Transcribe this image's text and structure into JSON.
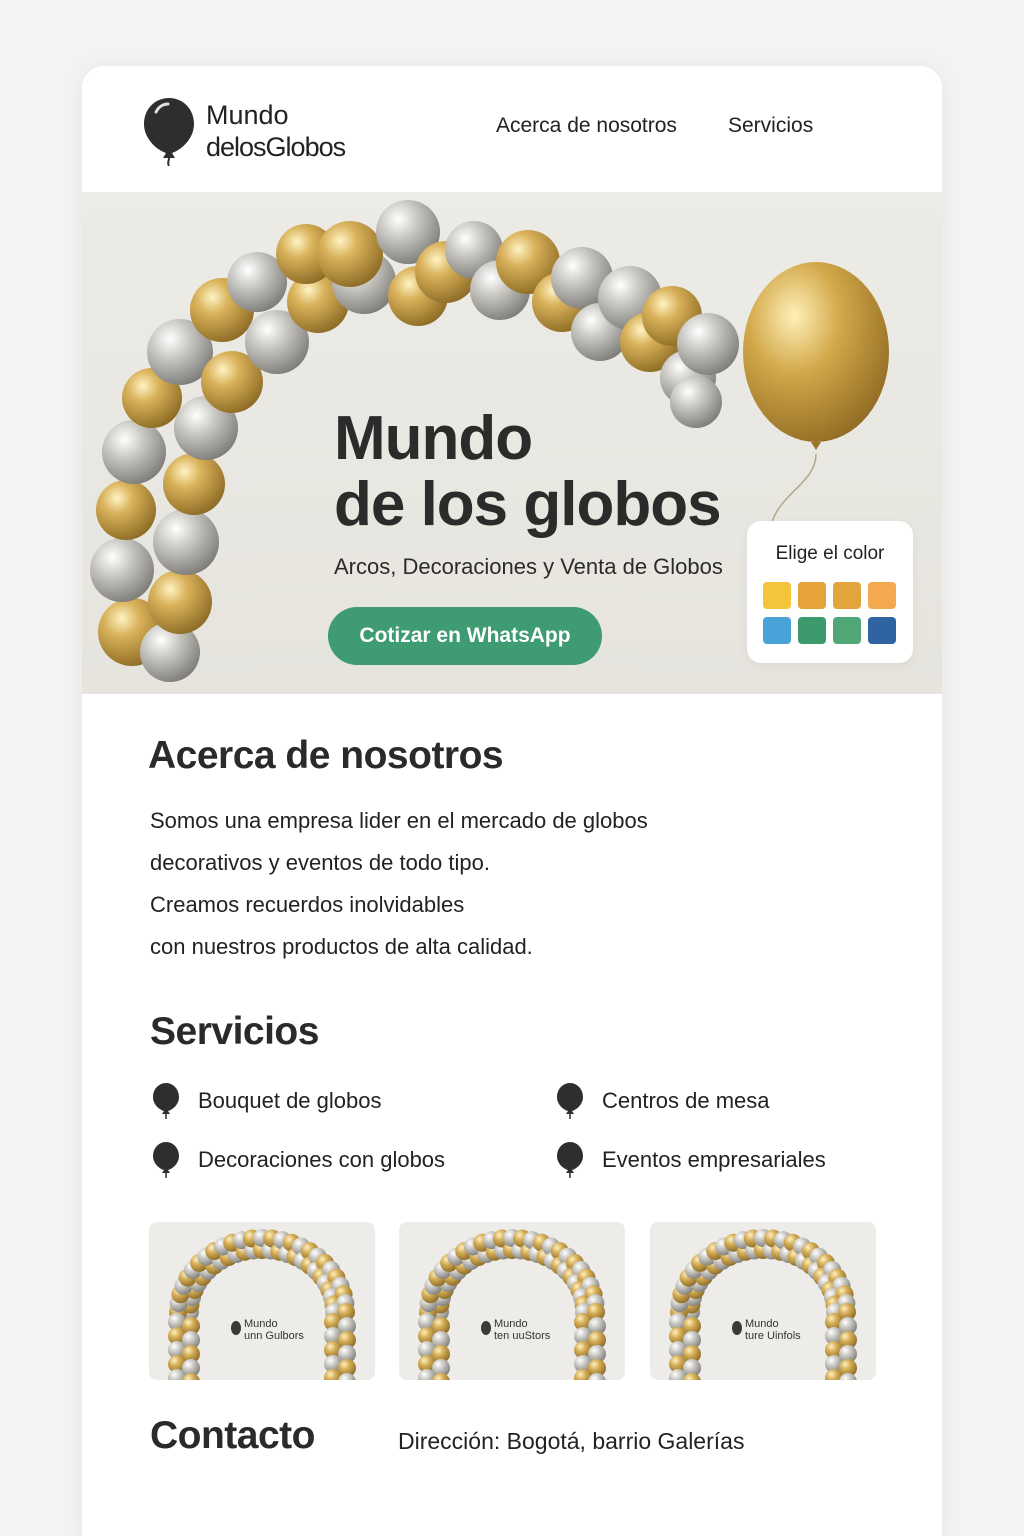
{
  "brand": {
    "line1": "Mundo",
    "line2": "delosGlobos"
  },
  "nav": {
    "about": "Acerca de nosotros",
    "services": "Servicios"
  },
  "hero": {
    "title_line1": "Mundo",
    "title_line2": "de los globos",
    "subtitle": "Arcos, Decoraciones y Venta de Globos",
    "cta": "Cotizar en WhatsApp"
  },
  "color_picker": {
    "title": "Elige el color",
    "swatches": [
      "#f4c43b",
      "#e5a33a",
      "#e3a43e",
      "#f5a94f",
      "#4aa3d8",
      "#3c9a6c",
      "#4fa676",
      "#2f63a1"
    ]
  },
  "about": {
    "title": "Acerca de nosotros",
    "lines": [
      "Somos una empresa lider en el mercado de globos",
      "decorativos y eventos de todo tipo.",
      "Creamos recuerdos inolvidables",
      "con nuestros productos de alta calidad."
    ]
  },
  "services": {
    "title": "Servicios",
    "items": [
      "Bouquet de globos",
      "Centros de mesa",
      "Decoraciones con globos",
      "Eventos empresariales"
    ]
  },
  "gallery": [
    {
      "line1": "Mundo",
      "line2": "unn Gulbors"
    },
    {
      "line1": "Mundo",
      "line2": "ten uuStors"
    },
    {
      "line1": "Mundo",
      "line2": "ture Uinfols"
    }
  ],
  "contact": {
    "title": "Contacto",
    "address": "Dirección: Bogotá, barrio Galerías"
  }
}
